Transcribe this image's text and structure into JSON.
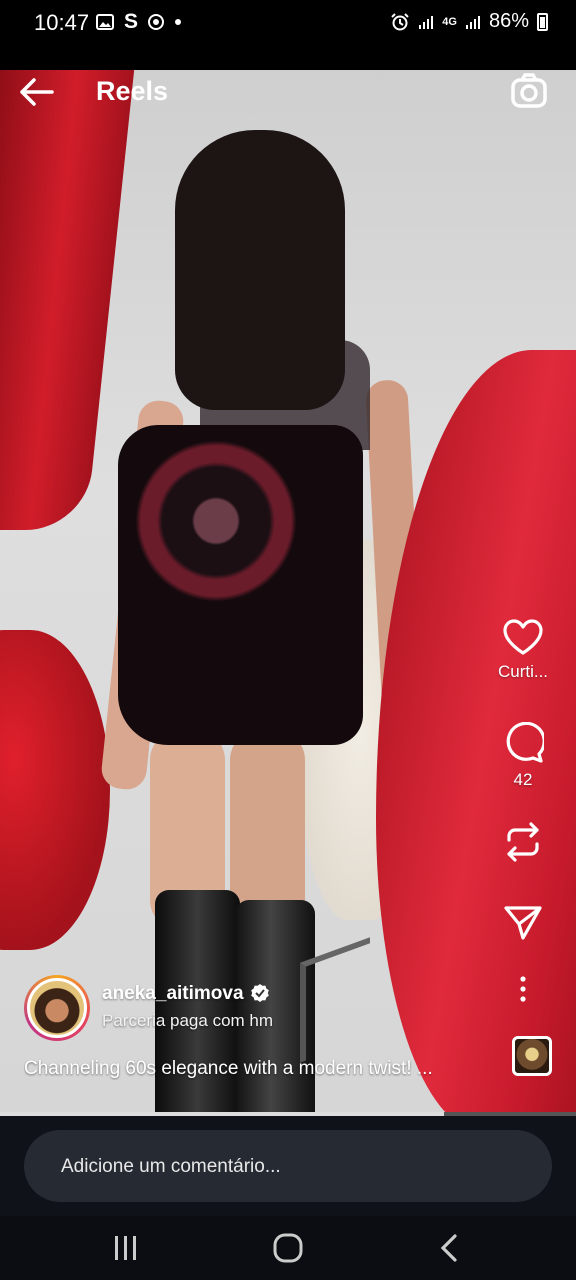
{
  "status_bar": {
    "time": "10:47",
    "left_icons": [
      "gallery-icon",
      "s-icon",
      "chrome-icon",
      "dot-icon"
    ],
    "right_icons": [
      "alarm-icon",
      "signal-icon",
      "4g-icon",
      "signal-icon",
      "battery-icon"
    ],
    "network": "4G",
    "battery": "86%"
  },
  "header": {
    "title": "Reels",
    "back_icon": "arrow-left-icon",
    "camera_icon": "camera-icon"
  },
  "actions": {
    "like_label": "Curti...",
    "comments_count": "42",
    "repost_icon": "repost-icon",
    "share_icon": "send-icon",
    "more_icon": "more-vertical-icon"
  },
  "author": {
    "username": "aneka_aitimova",
    "verified": true,
    "partnership": "Parceria paga com hm"
  },
  "caption": "Channeling 60s elegance with a modern twist! ...",
  "progress": 0.77,
  "comment": {
    "placeholder": "Adicione um comentário..."
  },
  "navbar": [
    "recents-icon",
    "home-icon",
    "back-icon"
  ],
  "colors": {
    "background": "#000000",
    "comment_bar": "#0f1218",
    "input": "#262a33",
    "verified": "#ffffff"
  }
}
